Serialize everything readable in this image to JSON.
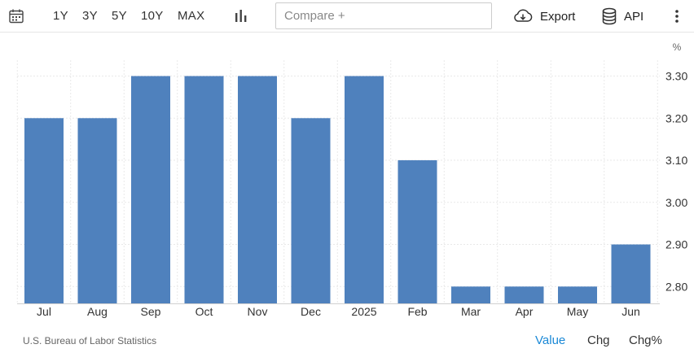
{
  "toolbar": {
    "ranges": [
      "1Y",
      "3Y",
      "5Y",
      "10Y",
      "MAX"
    ],
    "compare_placeholder": "Compare +",
    "export_label": "Export",
    "api_label": "API",
    "icons": [
      "calendar-icon",
      "bar-chart-icon",
      "cloud-download-icon",
      "database-icon",
      "more-vertical-icon"
    ]
  },
  "footer": {
    "source": "U.S. Bureau of Labor Statistics",
    "tabs": [
      {
        "label": "Value",
        "active": true
      },
      {
        "label": "Chg",
        "active": false
      },
      {
        "label": "Chg%",
        "active": false
      }
    ]
  },
  "colors": {
    "bar": "#4f81bd",
    "active_tab": "#1a88d6",
    "grid": "#e9e9e9"
  },
  "chart_data": {
    "type": "bar",
    "categories": [
      "Jul",
      "Aug",
      "Sep",
      "Oct",
      "Nov",
      "Dec",
      "2025",
      "Feb",
      "Mar",
      "Apr",
      "May",
      "Jun"
    ],
    "values": [
      3.2,
      3.2,
      3.3,
      3.3,
      3.3,
      3.2,
      3.3,
      3.1,
      2.8,
      2.8,
      2.8,
      2.9
    ],
    "unit": "%",
    "yticks": [
      "2.80",
      "2.90",
      "3.00",
      "3.10",
      "3.20",
      "3.30"
    ],
    "ylim": [
      2.76,
      3.33
    ],
    "grid": true,
    "y_axis_side": "right"
  }
}
